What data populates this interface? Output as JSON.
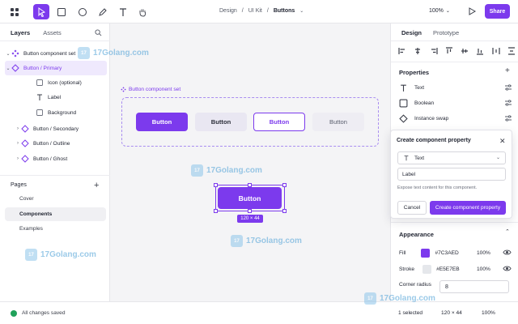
{
  "toolbar": {
    "tools": [
      "pointer-tool",
      "frame-tool",
      "ellipse-tool",
      "pen-tool",
      "text-tool",
      "hand-tool"
    ],
    "breadcrumb": [
      "Design",
      "UI Kit",
      "Buttons"
    ],
    "zoom": "100%",
    "share_label": "Share"
  },
  "left": {
    "tabs": [
      "Layers",
      "Assets"
    ],
    "layers": [
      {
        "label": "Button component set"
      },
      {
        "label": "Button / Primary"
      },
      {
        "label": "Icon (optional)"
      },
      {
        "label": "Label"
      },
      {
        "label": "Background"
      },
      {
        "label": "Button / Secondary"
      },
      {
        "label": "Button / Outline"
      },
      {
        "label": "Button / Ghost"
      }
    ],
    "pages_title": "Pages",
    "pages": [
      "Cover",
      "Components",
      "Examples"
    ]
  },
  "canvas": {
    "set_label": "Button component set",
    "buttons": [
      "Button",
      "Button",
      "Button",
      "Button"
    ],
    "selected_button": "Button",
    "selection_size": "120 × 44"
  },
  "right": {
    "tabs": [
      "Design",
      "Prototype"
    ],
    "properties_title": "Properties",
    "properties": [
      "Text",
      "Boolean",
      "Instance swap"
    ],
    "popover": {
      "title": "Create component property",
      "type": "Text",
      "name_value": "Label",
      "hint": "Expose text content for this component.",
      "cancel": "Cancel",
      "create": "Create component property"
    },
    "appearance_title": "Appearance",
    "fill": {
      "label": "Fill",
      "hex": "#7C3AED",
      "opacity": "100%",
      "color": "#7C3AED"
    },
    "stroke": {
      "label": "Stroke",
      "hex": "#E5E7EB",
      "opacity": "100%",
      "color": "#E5E7EB"
    },
    "corner_radius_label": "Corner radius",
    "corner_radius": "8"
  },
  "status": {
    "saved": "All changes saved",
    "selected": "1 selected",
    "size": "120 × 44",
    "zoom": "100%"
  },
  "watermark": "17Golang.com",
  "colors": {
    "accent": "#7C3AED",
    "success": "#1FA15A"
  }
}
